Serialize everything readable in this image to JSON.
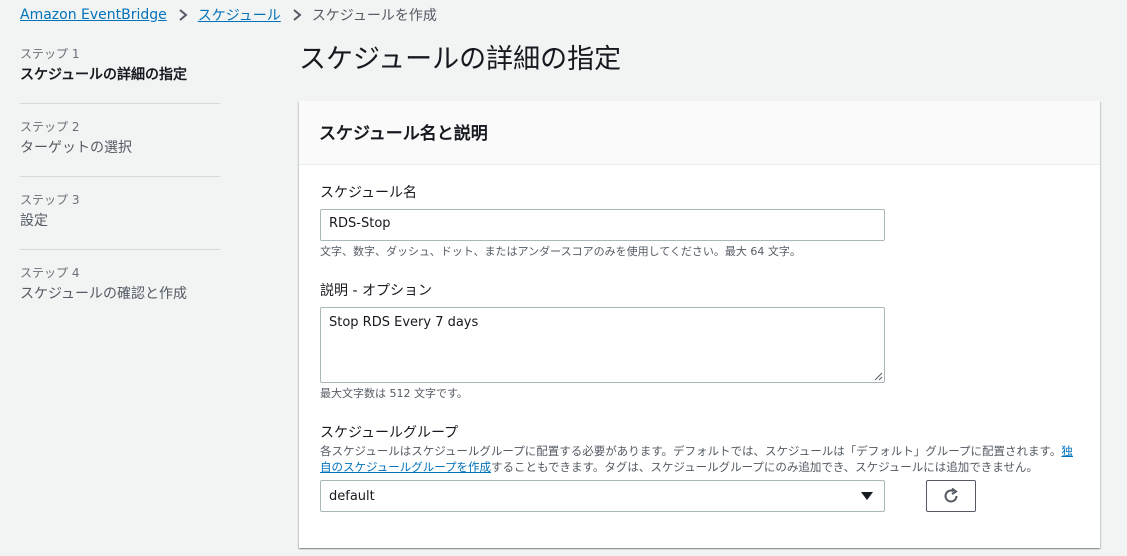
{
  "breadcrumb": {
    "items": [
      "Amazon EventBridge",
      "スケジュール"
    ],
    "current": "スケジュールを作成"
  },
  "steps": [
    {
      "num": "ステップ 1",
      "title": "スケジュールの詳細の指定",
      "active": true
    },
    {
      "num": "ステップ 2",
      "title": "ターゲットの選択",
      "active": false
    },
    {
      "num": "ステップ 3",
      "title": "設定",
      "active": false
    },
    {
      "num": "ステップ 4",
      "title": "スケジュールの確認と作成",
      "active": false
    }
  ],
  "page_title": "スケジュールの詳細の指定",
  "panel": {
    "title": "スケジュール名と説明",
    "name_field": {
      "label": "スケジュール名",
      "value": "RDS-Stop",
      "hint": "文字、数字、ダッシュ、ドット、またはアンダースコアのみを使用してください。最大 64 文字。"
    },
    "description_field": {
      "label": "説明 - オプション",
      "value": "Stop RDS Every 7 days",
      "hint": "最大文字数は 512 文字です。"
    },
    "group_field": {
      "label": "スケジュールグループ",
      "desc_before": "各スケジュールはスケジュールグループに配置する必要があります。デフォルトでは、スケジュールは「デフォルト」グループに配置されます。",
      "desc_link": "独自のスケジュールグループを作成",
      "desc_after": "することもできます。タグは、スケジュールグループにのみ追加でき、スケジュールには追加できません。",
      "selected": "default"
    }
  },
  "icons": {
    "breadcrumb_separator": "chevron-right-icon",
    "dropdown": "caret-down-icon",
    "refresh": "refresh-icon"
  }
}
